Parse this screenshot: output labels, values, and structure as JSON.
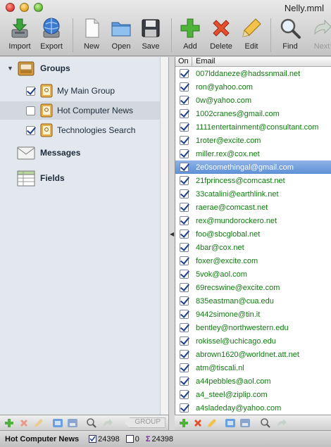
{
  "window": {
    "title": "Nelly.mml"
  },
  "toolbar": {
    "import": "Import",
    "export": "Export",
    "new": "New",
    "open": "Open",
    "save": "Save",
    "add": "Add",
    "delete": "Delete",
    "edit": "Edit",
    "find": "Find",
    "next": "Next"
  },
  "sidebar": {
    "groups_label": "Groups",
    "groups": [
      {
        "label": "My Main Group",
        "checked": true
      },
      {
        "label": "Hot Computer News",
        "checked": false,
        "selected": true
      },
      {
        "label": "Technologies Search",
        "checked": true
      }
    ],
    "messages_label": "Messages",
    "fields_label": "Fields"
  },
  "list": {
    "col_on": "On",
    "col_email": "Email",
    "selected_index": 7,
    "rows": [
      "007lddaneze@hadssnmail.net",
      "ron@yahoo.com",
      "0w@yahoo.com",
      "1002cranes@gmail.com",
      "1111entertainment@consultant.com",
      "1roter@excite.com",
      "miller.rex@cox.net",
      "2e0somethingal@gmail.com",
      "21fprincess@comcast.net",
      "33catalini@earthlink.net",
      "raerae@comcast.net",
      "rex@mundorockero.net",
      "foo@sbcglobal.net",
      "4bar@cox.net",
      "foxer@excite.com",
      "5vok@aol.com",
      "69recswine@excite.com",
      "835eastman@cua.edu",
      "9442simone@tin.it",
      "bentley@northwestern.edu",
      "rokissel@uchicago.edu",
      "abrown1620@worldnet.att.net",
      "atm@tiscali.nl",
      "a44pebbles@aol.com",
      "a4_steel@ziplip.com",
      "a4sladeday@yahoo.com"
    ]
  },
  "bottom": {
    "group_tag": "GROUP"
  },
  "status": {
    "group_name": "Hot Computer News",
    "checked_count": "24398",
    "unchecked_count": "0",
    "total_count": "24398"
  },
  "colors": {
    "email_text": "#0e7a0e",
    "selection": "#5e8fd6"
  }
}
